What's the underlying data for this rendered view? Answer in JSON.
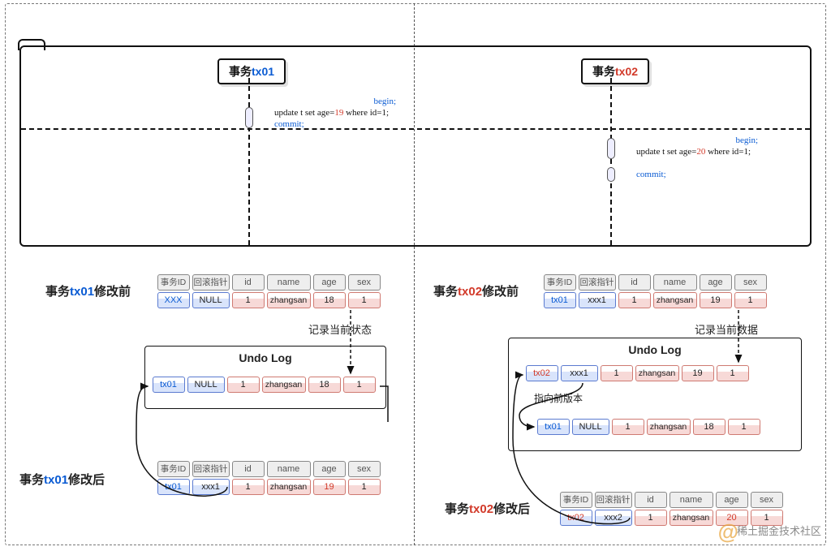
{
  "tx01": {
    "label_prefix": "事务",
    "label_id": "tx01",
    "begin": "begin;",
    "update_pre": "update t set  age=",
    "update_val": "19",
    "update_post": " where id=1;",
    "commit": "commit;",
    "before": {
      "title_pre": "事务",
      "title_id": "tx01",
      "title_post": "修改前",
      "headers": [
        "事务ID",
        "回滚指针",
        "id",
        "name",
        "age",
        "sex"
      ],
      "row": {
        "txid": "XXX",
        "ptr": "NULL",
        "id": "1",
        "name": "zhangsan",
        "age": "18",
        "sex": "1"
      }
    },
    "arrow_note": "记录当前状态",
    "undo": {
      "title": "Undo Log",
      "row": {
        "txid": "tx01",
        "ptr": "NULL",
        "id": "1",
        "name": "zhangsan",
        "age": "18",
        "sex": "1"
      }
    },
    "after": {
      "title_pre": "事务",
      "title_id": "tx01",
      "title_post": "修改后",
      "headers": [
        "事务ID",
        "回滚指针",
        "id",
        "name",
        "age",
        "sex"
      ],
      "row": {
        "txid": "tx01",
        "ptr": "xxx1",
        "id": "1",
        "name": "zhangsan",
        "age": "19",
        "sex": "1"
      }
    }
  },
  "tx02": {
    "label_prefix": "事务",
    "label_id": "tx02",
    "begin": "begin;",
    "update_pre": "update t set  age=",
    "update_val": "20",
    "update_post": " where id=1;",
    "commit": "commit;",
    "before": {
      "title_pre": "事务",
      "title_id": "tx02",
      "title_post": "修改前",
      "headers": [
        "事务ID",
        "回滚指针",
        "id",
        "name",
        "age",
        "sex"
      ],
      "row": {
        "txid": "tx01",
        "ptr": "xxx1",
        "id": "1",
        "name": "zhangsan",
        "age": "19",
        "sex": "1"
      }
    },
    "arrow_note": "记录当前数据",
    "undo": {
      "title": "Undo Log",
      "row1": {
        "txid": "tx02",
        "ptr": "xxx1",
        "id": "1",
        "name": "zhangsan",
        "age": "19",
        "sex": "1"
      },
      "ptr_note": "指向前版本",
      "row2": {
        "txid": "tx01",
        "ptr": "NULL",
        "id": "1",
        "name": "zhangsan",
        "age": "18",
        "sex": "1"
      }
    },
    "after": {
      "title_pre": "事务",
      "title_id": "tx02",
      "title_post": "修改后",
      "headers": [
        "事务ID",
        "回滚指针",
        "id",
        "name",
        "age",
        "sex"
      ],
      "row": {
        "txid": "tx02",
        "ptr": "xxx2",
        "id": "1",
        "name": "zhangsan",
        "age": "20",
        "sex": "1"
      }
    }
  },
  "watermark": "稀土掘金技术社区"
}
